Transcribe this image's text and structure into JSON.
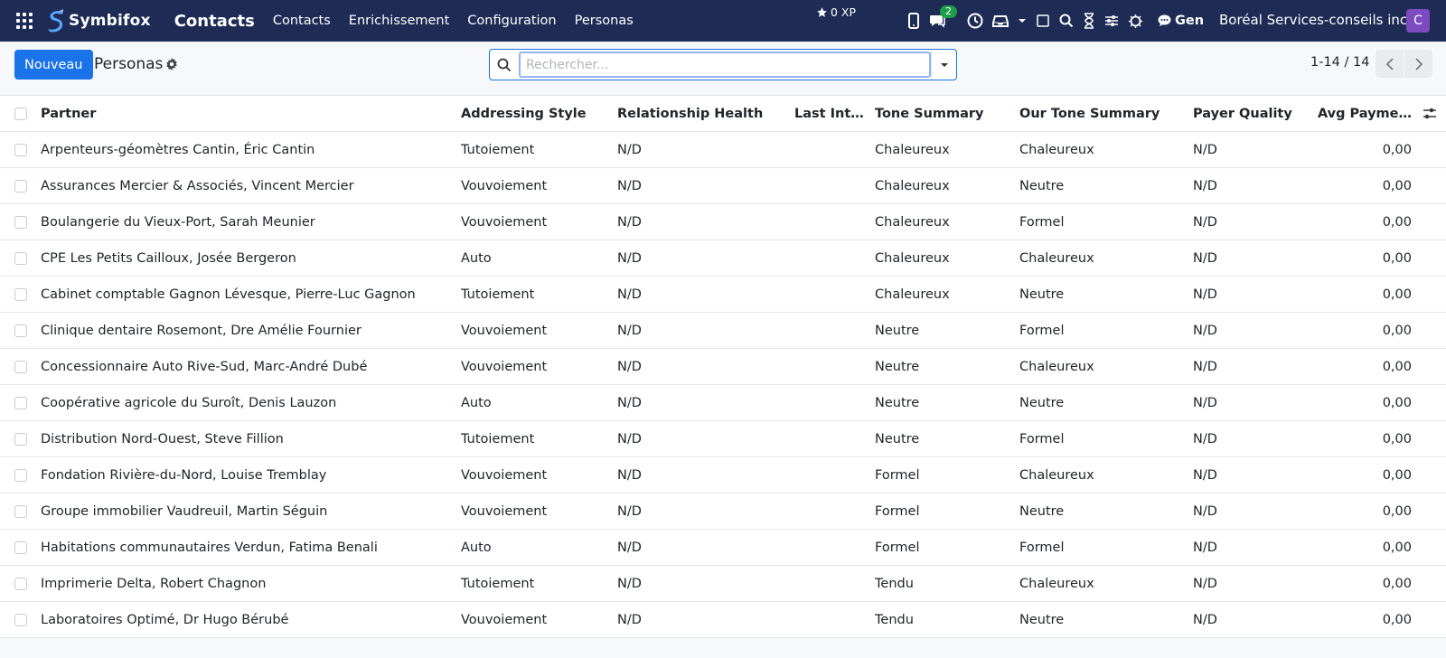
{
  "navbar": {
    "brand": "Symbifox",
    "app_title": "Contacts",
    "menu": [
      "Contacts",
      "Enrichissement",
      "Configuration",
      "Personas"
    ],
    "xp": "0 XP",
    "chat_badge": "2",
    "gen_label": "Gen",
    "company": "Boréal Services-conseils inc.",
    "avatar_initial": "C"
  },
  "control": {
    "new_button": "Nouveau",
    "view_title": "Personas",
    "search_placeholder": "Rechercher...",
    "pager": "1-14 / 14"
  },
  "table": {
    "headers": {
      "partner": "Partner",
      "style": "Addressing Style",
      "health": "Relationship Health",
      "last": "Last Inte…",
      "tone": "Tone Summary",
      "our": "Our Tone Summary",
      "payer": "Payer Quality",
      "avg": "Avg Payme…"
    },
    "rows": [
      {
        "partner": "Arpenteurs-géomètres Cantin, Éric Cantin",
        "style": "Tutoiement",
        "health": "N/D",
        "last": "",
        "tone": "Chaleureux",
        "our": "Chaleureux",
        "payer": "N/D",
        "avg": "0,00"
      },
      {
        "partner": "Assurances Mercier & Associés, Vincent Mercier",
        "style": "Vouvoiement",
        "health": "N/D",
        "last": "",
        "tone": "Chaleureux",
        "our": "Neutre",
        "payer": "N/D",
        "avg": "0,00"
      },
      {
        "partner": "Boulangerie du Vieux-Port, Sarah Meunier",
        "style": "Vouvoiement",
        "health": "N/D",
        "last": "",
        "tone": "Chaleureux",
        "our": "Formel",
        "payer": "N/D",
        "avg": "0,00"
      },
      {
        "partner": "CPE Les Petits Cailloux, Josée Bergeron",
        "style": "Auto",
        "health": "N/D",
        "last": "",
        "tone": "Chaleureux",
        "our": "Chaleureux",
        "payer": "N/D",
        "avg": "0,00"
      },
      {
        "partner": "Cabinet comptable Gagnon Lévesque, Pierre-Luc Gagnon",
        "style": "Tutoiement",
        "health": "N/D",
        "last": "",
        "tone": "Chaleureux",
        "our": "Neutre",
        "payer": "N/D",
        "avg": "0,00"
      },
      {
        "partner": "Clinique dentaire Rosemont, Dre Amélie Fournier",
        "style": "Vouvoiement",
        "health": "N/D",
        "last": "",
        "tone": "Neutre",
        "our": "Formel",
        "payer": "N/D",
        "avg": "0,00"
      },
      {
        "partner": "Concessionnaire Auto Rive-Sud, Marc-André Dubé",
        "style": "Vouvoiement",
        "health": "N/D",
        "last": "",
        "tone": "Neutre",
        "our": "Chaleureux",
        "payer": "N/D",
        "avg": "0,00"
      },
      {
        "partner": "Coopérative agricole du Suroît, Denis Lauzon",
        "style": "Auto",
        "health": "N/D",
        "last": "",
        "tone": "Neutre",
        "our": "Neutre",
        "payer": "N/D",
        "avg": "0,00"
      },
      {
        "partner": "Distribution Nord-Ouest, Steve Fillion",
        "style": "Tutoiement",
        "health": "N/D",
        "last": "",
        "tone": "Neutre",
        "our": "Formel",
        "payer": "N/D",
        "avg": "0,00"
      },
      {
        "partner": "Fondation Rivière-du-Nord, Louise Tremblay",
        "style": "Vouvoiement",
        "health": "N/D",
        "last": "",
        "tone": "Formel",
        "our": "Chaleureux",
        "payer": "N/D",
        "avg": "0,00"
      },
      {
        "partner": "Groupe immobilier Vaudreuil, Martin Séguin",
        "style": "Vouvoiement",
        "health": "N/D",
        "last": "",
        "tone": "Formel",
        "our": "Neutre",
        "payer": "N/D",
        "avg": "0,00"
      },
      {
        "partner": "Habitations communautaires Verdun, Fatima Benali",
        "style": "Auto",
        "health": "N/D",
        "last": "",
        "tone": "Formel",
        "our": "Formel",
        "payer": "N/D",
        "avg": "0,00"
      },
      {
        "partner": "Imprimerie Delta, Robert Chagnon",
        "style": "Tutoiement",
        "health": "N/D",
        "last": "",
        "tone": "Tendu",
        "our": "Chaleureux",
        "payer": "N/D",
        "avg": "0,00"
      },
      {
        "partner": "Laboratoires Optimé, Dr Hugo Bérubé",
        "style": "Vouvoiement",
        "health": "N/D",
        "last": "",
        "tone": "Tendu",
        "our": "Neutre",
        "payer": "N/D",
        "avg": "0,00"
      }
    ]
  }
}
